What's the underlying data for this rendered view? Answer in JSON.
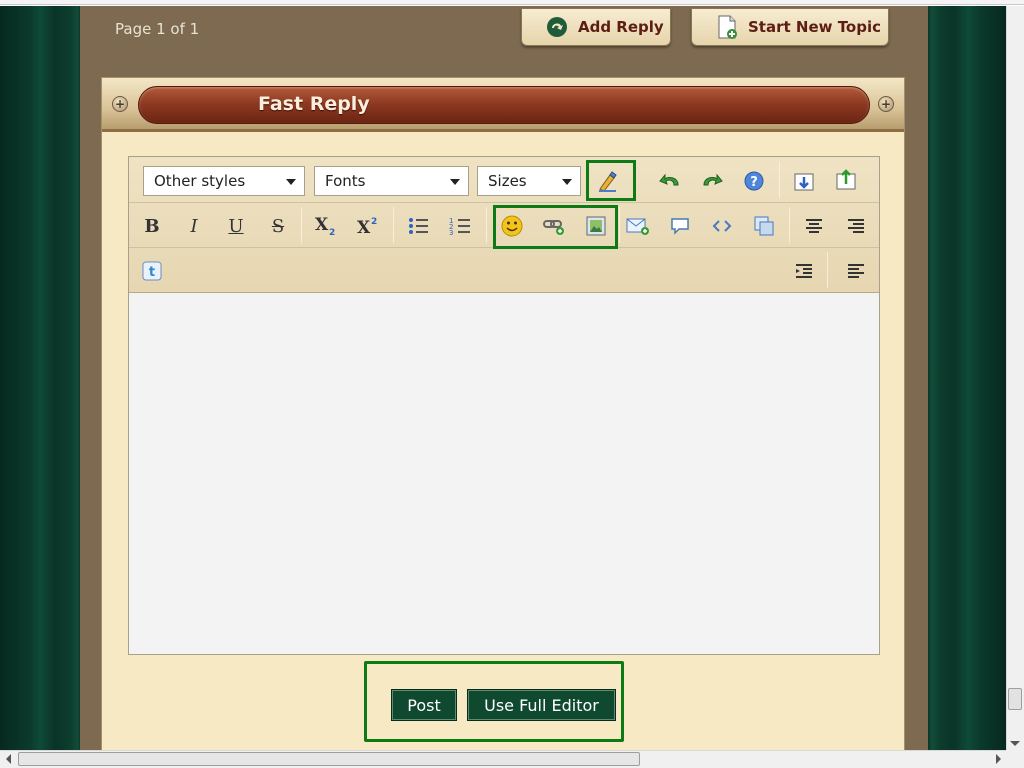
{
  "pagination": {
    "text": "Page 1 of 1"
  },
  "top_buttons": {
    "add_reply": "Add Reply",
    "start_new_topic": "Start New Topic"
  },
  "panel": {
    "title": "Fast Reply"
  },
  "editor": {
    "styles_select": "Other styles",
    "fonts_select": "Fonts",
    "sizes_select": "Sizes",
    "bold_glyph": "B",
    "italic_glyph": "I",
    "underline_glyph": "U",
    "strike_glyph": "S",
    "textarea_value": ""
  },
  "actions": {
    "post": "Post",
    "full_editor": "Use Full Editor"
  },
  "colors": {
    "highlight": "#0e7a16",
    "action_button": "#0f4a30",
    "header_bar": "#8e3a22",
    "panel_bg": "#f6e9c3"
  }
}
